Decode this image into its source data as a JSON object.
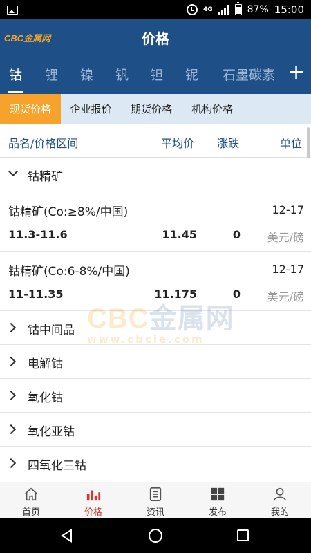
{
  "status_bar": {
    "network": "4G",
    "battery": "87%",
    "time": "15:00"
  },
  "header": {
    "logo": "CBC金属网",
    "title": "价格"
  },
  "metal_tabs": [
    "钴",
    "锂",
    "镍",
    "钒",
    "钽",
    "铌",
    "石墨碳素"
  ],
  "plus_label": "+",
  "sub_tabs": [
    "现货价格",
    "企业报价",
    "期货价格",
    "机构价格"
  ],
  "columns": {
    "name": "品名/价格区间",
    "avg": "平均价",
    "change": "涨跌",
    "unit": "单位"
  },
  "expanded_category": "钴精矿",
  "items": [
    {
      "name": "钴精矿(Co:≥8%/中国)",
      "date": "12-17",
      "range": "11.3-11.6",
      "avg": "11.45",
      "change": "0",
      "unit": "美元/磅"
    },
    {
      "name": "钴精矿(Co:6-8%/中国)",
      "date": "12-17",
      "range": "11-11.35",
      "avg": "11.175",
      "change": "0",
      "unit": "美元/磅"
    }
  ],
  "categories": [
    "钴中间品",
    "电解钴",
    "氧化钴",
    "氧化亚钴",
    "四氧化三钴"
  ],
  "watermark": {
    "brand_latin": "CBC",
    "brand_cn": "金属网",
    "url": "www.cbcie.com"
  },
  "bottom_nav": [
    "首页",
    "价格",
    "资讯",
    "发布",
    "我的"
  ],
  "colors": {
    "header_bg": "#1e4f86",
    "accent_orange": "#f7a32b",
    "active_nav": "#d9362b",
    "subtab_bg": "#dce9f4"
  }
}
